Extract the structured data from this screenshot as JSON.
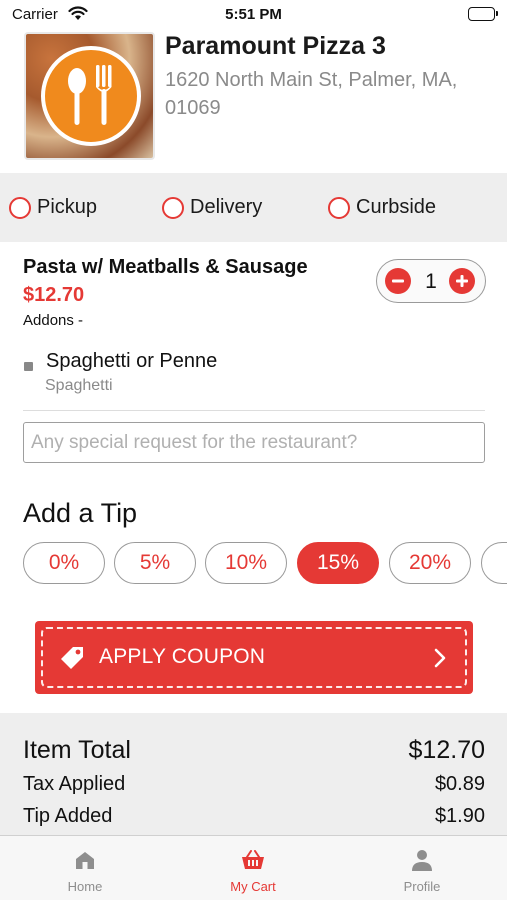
{
  "status_bar": {
    "carrier": "Carrier",
    "time": "5:51 PM"
  },
  "restaurant": {
    "name": "Paramount Pizza 3",
    "address": "1620 North Main St, Palmer, MA, 01069",
    "logo_icon": "spoon-fork-icon"
  },
  "order_types": [
    {
      "label": "Pickup",
      "selected": false
    },
    {
      "label": "Delivery",
      "selected": false
    },
    {
      "label": "Curbside",
      "selected": false
    }
  ],
  "cart_item": {
    "name": "Pasta w/ Meatballs & Sausage",
    "price": "$12.70",
    "addons_label": "Addons -",
    "quantity": "1",
    "option": {
      "label": "Spaghetti or Penne",
      "value": "Spaghetti"
    }
  },
  "special_request": {
    "placeholder": "Any special request for the restaurant?",
    "value": ""
  },
  "tip": {
    "heading": "Add a Tip",
    "options": [
      "0%",
      "5%",
      "10%",
      "15%",
      "20%"
    ],
    "selected": "15%"
  },
  "coupon": {
    "label": "APPLY COUPON",
    "icon": "tag-icon"
  },
  "summary": {
    "item_total_label": "Item Total",
    "item_total": "$12.70",
    "tax_label": "Tax Applied",
    "tax": "$0.89",
    "tip_label": "Tip Added",
    "tip": "$1.90"
  },
  "tabs": [
    {
      "label": "Home",
      "icon": "home-icon",
      "active": false
    },
    {
      "label": "My Cart",
      "icon": "basket-icon",
      "active": true
    },
    {
      "label": "Profile",
      "icon": "person-icon",
      "active": false
    }
  ],
  "colors": {
    "accent": "#e53935",
    "logo_orange": "#f08a1d",
    "panel_gray": "#eeeeee"
  }
}
